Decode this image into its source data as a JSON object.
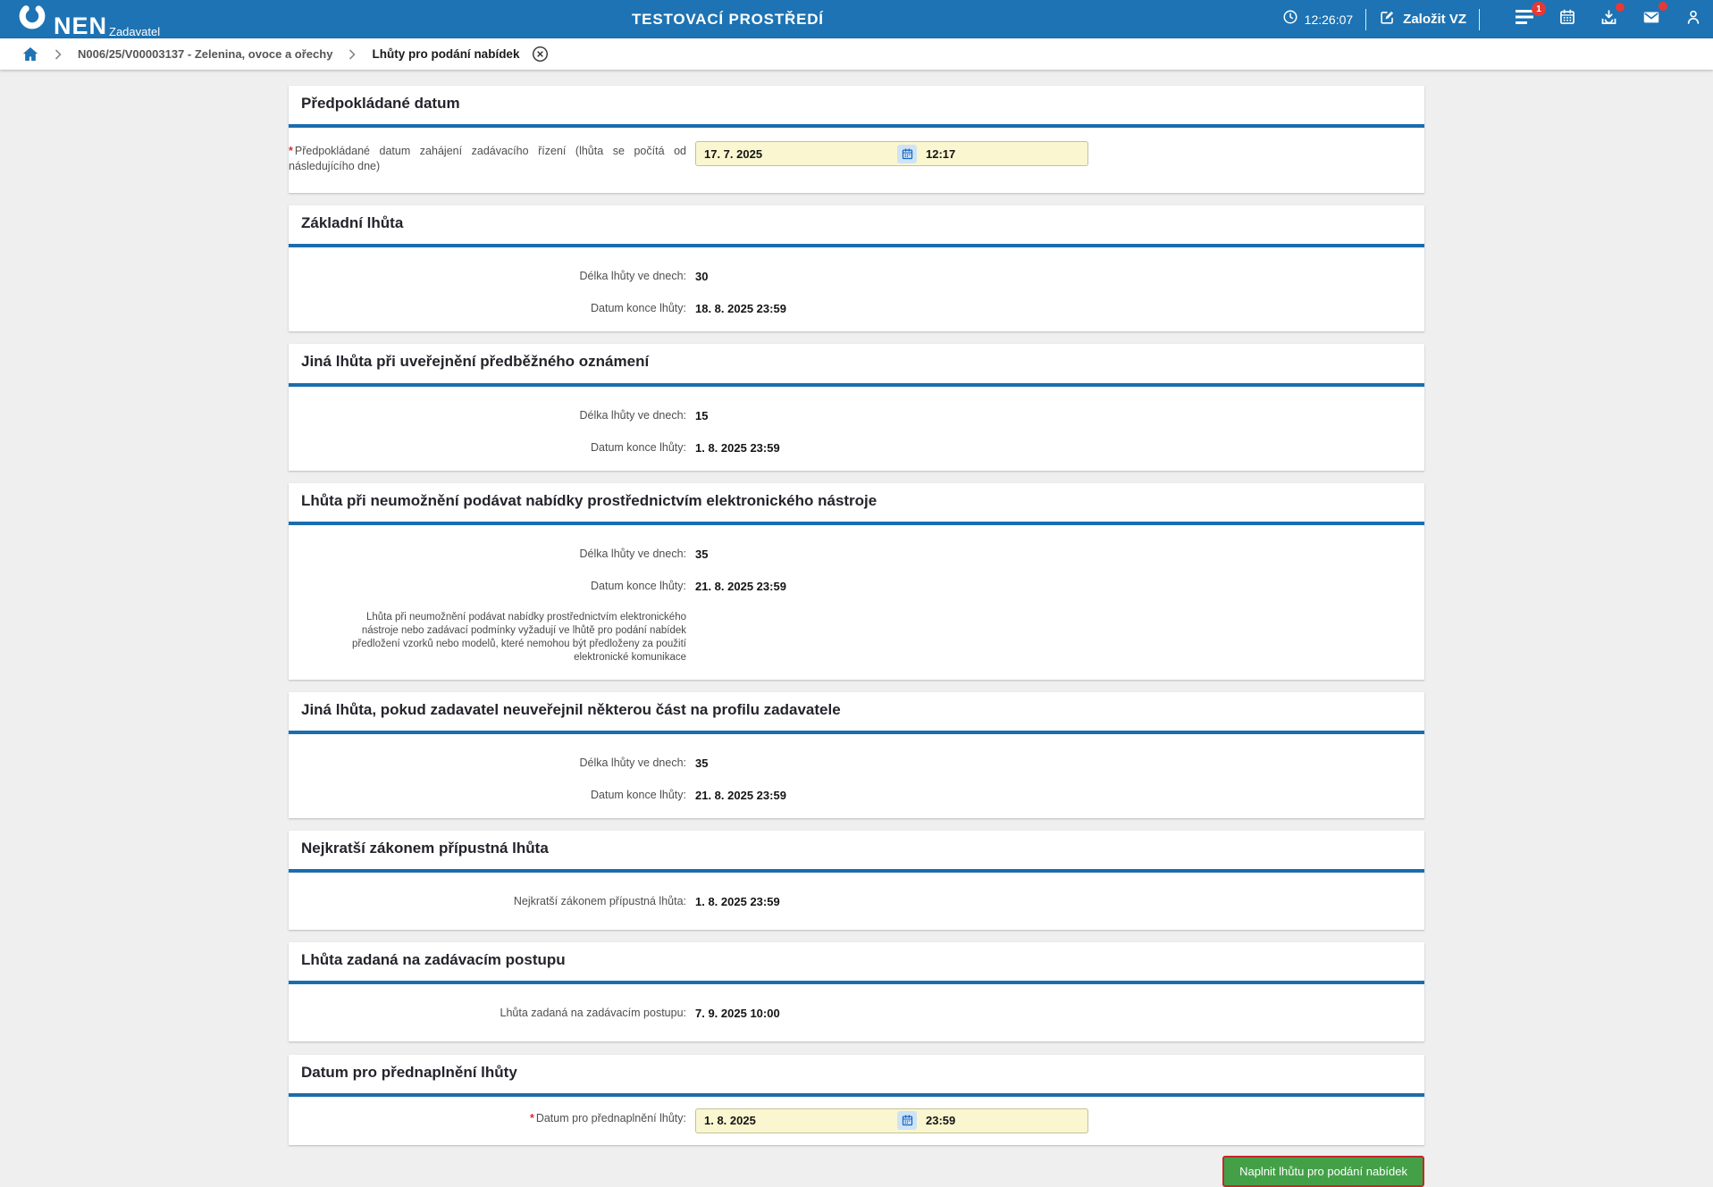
{
  "colors": {
    "header_blue": "#1d73b3",
    "section_rule_blue": "#1a6dae",
    "page_bg": "#efefef",
    "input_yellow": "#faf7d0",
    "button_green": "#43a047",
    "button_focus_red": "#c62828",
    "badge_red": "#e53935"
  },
  "icons": [
    "clock-icon",
    "edit-square-icon",
    "menu-icon",
    "calendar-icon",
    "inbox-download-icon",
    "mail-icon",
    "user-icon",
    "home-icon",
    "chevron-right-icon",
    "close-circle-icon",
    "calendar-picker-icon",
    "nen-swoosh-logo"
  ],
  "header": {
    "brand": "NEN",
    "brand_sub": "Zadavatel",
    "env_title": "TESTOVACÍ PROSTŘEDÍ",
    "clock_time": "12:26:07",
    "create_vz_label": "Založit VZ",
    "menu_badge": "1"
  },
  "breadcrumb": {
    "item1": "N006/25/V00003137 - Zelenina, ovoce a ořechy",
    "item2": "Lhůty pro podání nabídek"
  },
  "required_marker": "*",
  "sections": {
    "s1": {
      "title": "Předpokládané datum",
      "field_label": "Předpokládané datum zahájení zadávacího řízení (lhůta se počítá od následujícího dne)",
      "date": "17. 7. 2025",
      "time": "12:17"
    },
    "s2": {
      "title": "Základní lhůta",
      "rows": [
        {
          "label": "Délka lhůty ve dnech:",
          "value": "30"
        },
        {
          "label": "Datum konce lhůty:",
          "value": "18. 8. 2025 23:59"
        }
      ]
    },
    "s3": {
      "title": "Jiná lhůta při uveřejnění předběžného oznámení",
      "rows": [
        {
          "label": "Délka lhůty ve dnech:",
          "value": "15"
        },
        {
          "label": "Datum konce lhůty:",
          "value": "1. 8. 2025 23:59"
        }
      ]
    },
    "s4": {
      "title": "Lhůta při neumožnění podávat nabídky prostřednictvím elektronického nástroje",
      "rows": [
        {
          "label": "Délka lhůty ve dnech:",
          "value": "35"
        },
        {
          "label": "Datum konce lhůty:",
          "value": "21. 8. 2025 23:59"
        }
      ],
      "note": "Lhůta při neumožnění podávat nabídky prostřednictvím elektronického nástroje nebo zadávací podmínky vyžadují ve lhůtě pro podání nabídek předložení vzorků nebo modelů, které nemohou být předloženy za použití elektronické komunikace"
    },
    "s5": {
      "title": "Jiná lhůta, pokud zadavatel neuveřejnil některou část na profilu zadavatele",
      "rows": [
        {
          "label": "Délka lhůty ve dnech:",
          "value": "35"
        },
        {
          "label": "Datum konce lhůty:",
          "value": "21. 8. 2025 23:59"
        }
      ]
    },
    "s6": {
      "title": "Nejkratší zákonem přípustná lhůta",
      "rows": [
        {
          "label": "Nejkratší zákonem přípustná lhůta:",
          "value": "1. 8. 2025 23:59"
        }
      ]
    },
    "s7": {
      "title": "Lhůta zadaná na zadávacím postupu",
      "rows": [
        {
          "label": "Lhůta zadaná na zadávacím postupu:",
          "value": "7. 9. 2025 10:00"
        }
      ]
    },
    "s8": {
      "title": "Datum pro přednaplnění lhůty",
      "field_label": "Datum pro přednaplnění lhůty:",
      "date": "1. 8. 2025",
      "time": "23:59"
    }
  },
  "footer": {
    "action_label": "Naplnit lhůtu pro podání nabídek"
  }
}
